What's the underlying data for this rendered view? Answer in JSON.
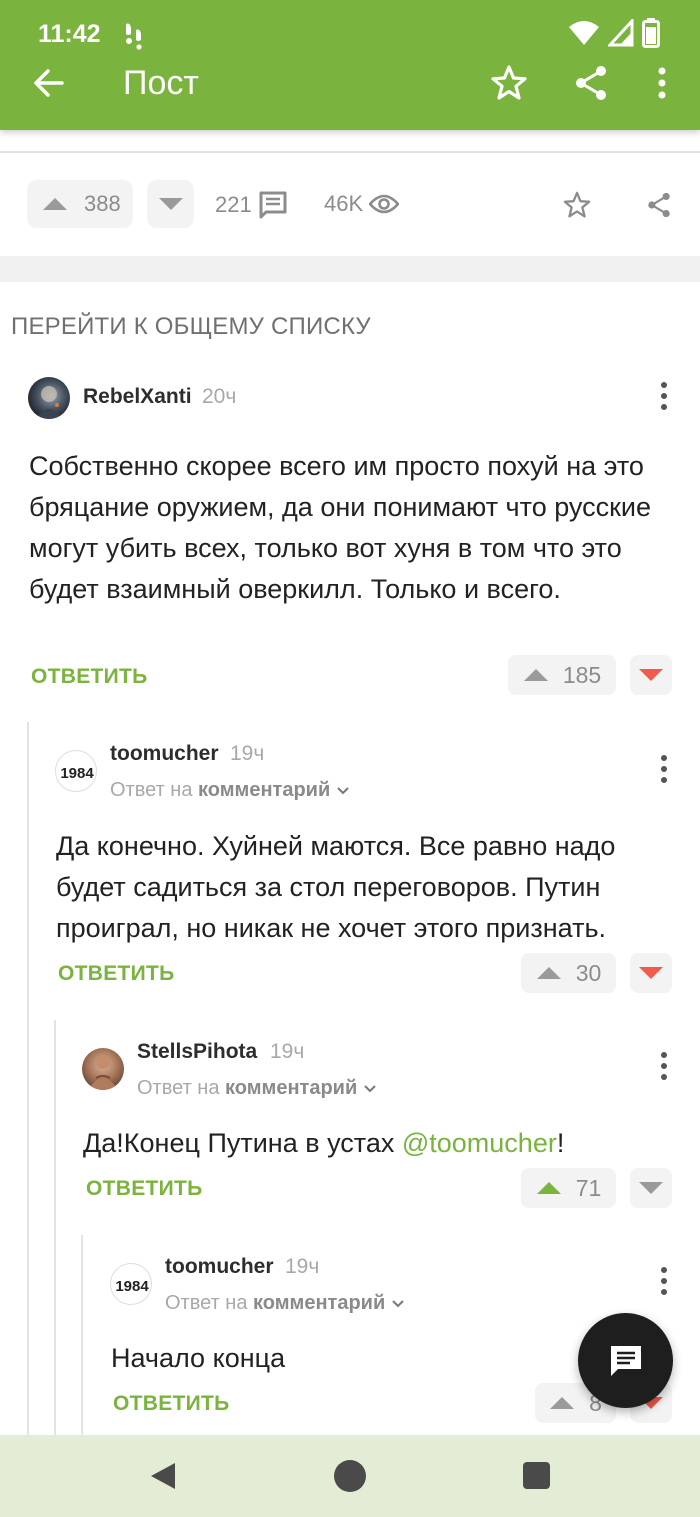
{
  "status_bar": {
    "time": "11:42"
  },
  "app_bar": {
    "title": "Пост"
  },
  "post_stats": {
    "upvotes": "388",
    "comments": "221",
    "views": "46K"
  },
  "goto_all_label": "ПЕРЕЙТИ К ОБЩЕМУ СПИСКУ",
  "comments": [
    {
      "username": "RebelXanti",
      "time": "20ч",
      "text": "Собственно скорее всего им просто похуй на это бряцание оружием, да они понимают что русские могут убить всех, только вот хуня в том что это будет взаимный оверкилл. Только и всего.",
      "reply_label": "ОТВЕТИТЬ",
      "votes": "185",
      "down_color": "#f05b4a"
    },
    {
      "username": "toomucher",
      "time": "19ч",
      "reply_to_prefix": "Ответ на",
      "reply_to_target": "комментарий",
      "text": "Да конечно. Хуйней маются. Все равно надо будет садиться за стол переговоров. Путин проиграл, но никак не хочет этого признать.",
      "reply_label": "ОТВЕТИТЬ",
      "votes": "30",
      "down_color": "#f05b4a"
    },
    {
      "username": "StellsPihota",
      "time": "19ч",
      "reply_to_prefix": "Ответ на",
      "reply_to_target": "комментарий",
      "text_before": "Да!Конец Путина в устах ",
      "mention": "@toomucher",
      "text_after": "!",
      "reply_label": "ОТВЕТИТЬ",
      "votes": "71",
      "up_color": "#7ab33e"
    },
    {
      "username": "toomucher",
      "time": "19ч",
      "reply_to_prefix": "Ответ на",
      "reply_to_target": "комментарий",
      "text": "Начало конца",
      "reply_label": "ОТВЕТИТЬ",
      "votes": "8",
      "down_color": "#f05b4a"
    }
  ],
  "avatar_1984_text": "1984",
  "colors": {
    "brand_green": "#7ab33e",
    "downvote_red": "#f05b4a",
    "nav_bg": "#e3edd6"
  }
}
